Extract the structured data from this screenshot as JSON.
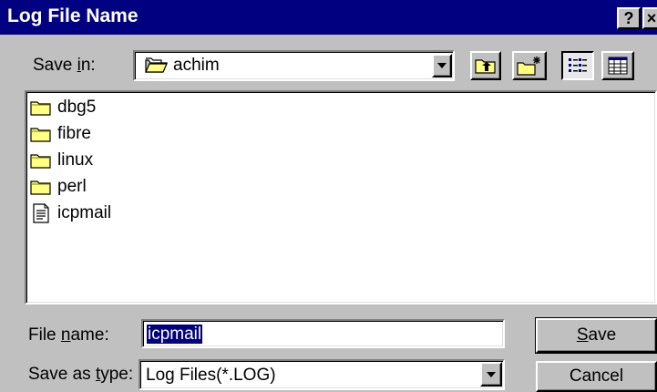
{
  "window": {
    "title": "Log File Name",
    "help_glyph": "?",
    "close_glyph": "×"
  },
  "save_in": {
    "label_prefix": "Save ",
    "label_mnemonic": "i",
    "label_suffix": "n:",
    "value": "achim",
    "icon": "folder-icon"
  },
  "toolbar": {
    "up_one_level_icon": "up-folder-icon",
    "new_folder_icon": "new-folder-icon",
    "list_view_icon": "list-view-icon",
    "details_view_icon": "details-view-icon"
  },
  "file_list": {
    "items": [
      {
        "name": "dbg5",
        "type": "folder"
      },
      {
        "name": "fibre",
        "type": "folder"
      },
      {
        "name": "linux",
        "type": "folder"
      },
      {
        "name": "perl",
        "type": "folder"
      },
      {
        "name": "icpmail",
        "type": "file"
      }
    ]
  },
  "file_name": {
    "label_prefix": "File ",
    "label_mnemonic": "n",
    "label_suffix": "ame:",
    "value": "icpmail"
  },
  "save_as_type": {
    "label_prefix": "Save as ",
    "label_mnemonic": "t",
    "label_suffix": "ype:",
    "value": "Log Files(*.LOG)"
  },
  "buttons": {
    "save_mnemonic": "S",
    "save_rest": "ave",
    "cancel": "Cancel"
  },
  "colors": {
    "titlebar": "#000080",
    "face": "#c0c0c0",
    "folder": "#ffff80"
  }
}
